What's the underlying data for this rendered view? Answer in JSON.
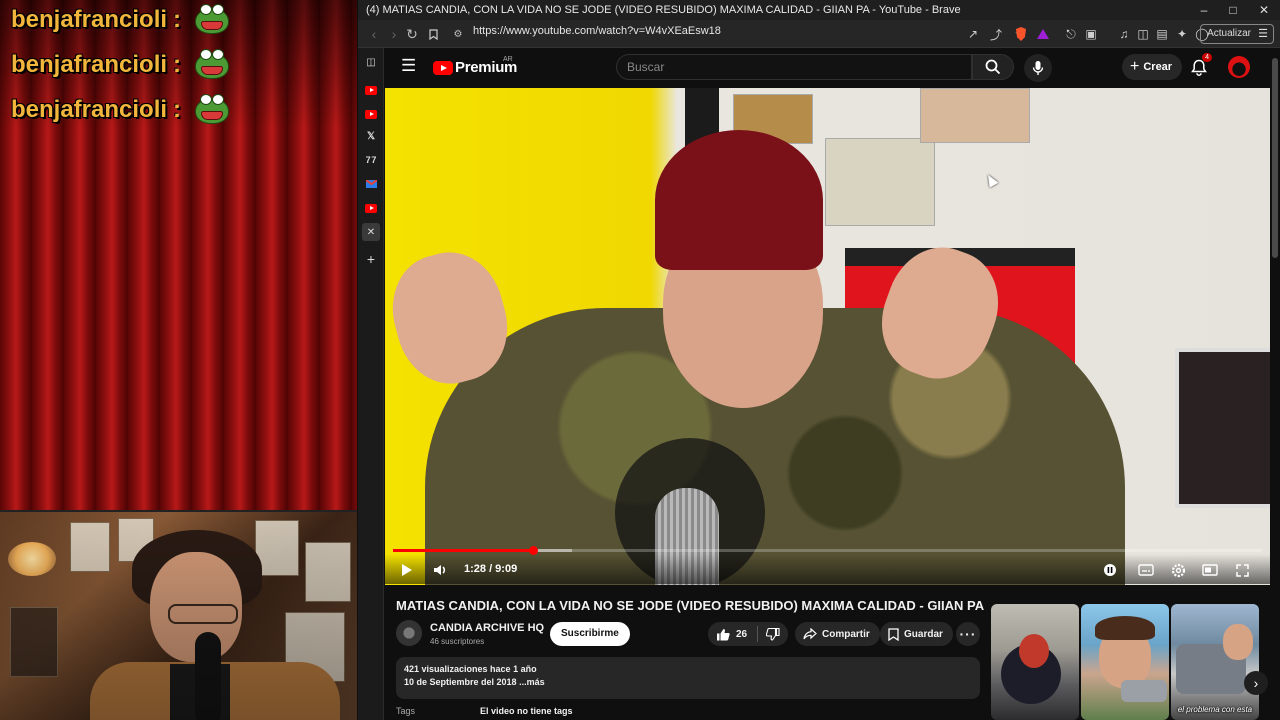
{
  "overlay": {
    "chat": [
      {
        "user": "benjafrancioli",
        "sep": ":",
        "emote": "frog-emote"
      },
      {
        "user": "benjafrancioli",
        "sep": ":",
        "emote": "frog-emote"
      },
      {
        "user": "benjafrancioli",
        "sep": ":",
        "emote": "frog-emote"
      }
    ]
  },
  "browser": {
    "title": "(4) MATIAS CANDIA, CON LA VIDA NO SE JODE (VIDEO RESUBIDO) MAXIMA CALIDAD - GIIAN PA - YouTube - Brave",
    "url": "https://www.youtube.com/watch?v=W4vXEaEsw18",
    "update_label": "Actualizar",
    "shield_count": "27"
  },
  "youtube": {
    "logo_text": "Premium",
    "region": "AR",
    "search_placeholder": "Buscar",
    "create_label": "Crear",
    "notifications": "4",
    "player": {
      "time": "1:28 / 9:09",
      "progress_played": 0.161,
      "progress_loaded": 0.206
    },
    "video_title": "MATIAS CANDIA, CON LA VIDA NO SE JODE (VIDEO RESUBIDO) MAXIMA CALIDAD - GIIAN PA",
    "channel_name": "CANDIA ARCHIVE HQ",
    "subscribers": "46 suscriptores",
    "subscribe_label": "Suscribirme",
    "likes": "26",
    "share_label": "Compartir",
    "save_label": "Guardar",
    "description": {
      "views_line": "421 visualizaciones  hace 1 año",
      "date_line": "10 de Septiembre del 2018 ",
      "more": "...más"
    },
    "tags_label": "Tags",
    "tags_value": "El video no tiene tags",
    "thumbnails": [
      {
        "caption": ""
      },
      {
        "caption": ""
      },
      {
        "caption": "el problema con esta"
      }
    ]
  }
}
